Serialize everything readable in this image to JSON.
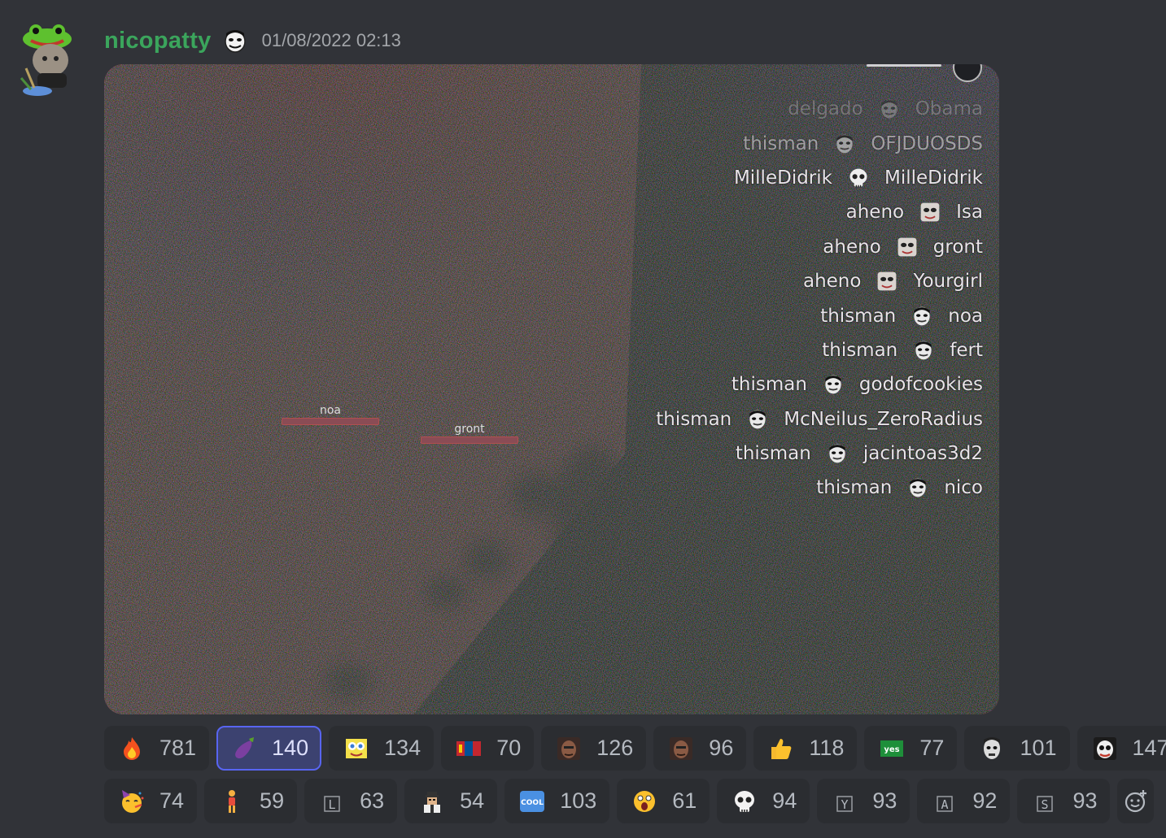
{
  "message": {
    "username": "nicopatty",
    "timestamp": "01/08/2022 02:13"
  },
  "colors": {
    "username": "#3ba55c",
    "background": "#313338",
    "reaction_bg": "#2b2d31",
    "reaction_selected_bg": "#3c4270",
    "reaction_selected_border": "#5865f2"
  },
  "embed": {
    "nametags": [
      {
        "label": "noa"
      },
      {
        "label": "gront"
      }
    ],
    "kill_feed": [
      {
        "killer": "delgado",
        "victim": "Obama"
      },
      {
        "killer": "thisman",
        "victim": "OFJDUOSDS"
      },
      {
        "killer": "MilleDidrik",
        "victim": "MilleDidrik",
        "icon": "skull-icon"
      },
      {
        "killer": "aheno",
        "victim": "Isa"
      },
      {
        "killer": "aheno",
        "victim": "gront"
      },
      {
        "killer": "aheno",
        "victim": "Yourgirl"
      },
      {
        "killer": "thisman",
        "victim": "noa"
      },
      {
        "killer": "thisman",
        "victim": "fert"
      },
      {
        "killer": "thisman",
        "victim": "godofcookies"
      },
      {
        "killer": "thisman",
        "victim": "McNeilus_ZeroRadius"
      },
      {
        "killer": "thisman",
        "victim": "jacintoas3d2"
      },
      {
        "killer": "thisman",
        "victim": "nico"
      }
    ]
  },
  "reactions": [
    [
      {
        "icon": "fire-icon",
        "count": "781"
      },
      {
        "icon": "eggplant-icon",
        "count": "140",
        "selected": true
      },
      {
        "icon": "spongebob-face-icon",
        "count": "134"
      },
      {
        "icon": "mongolia-flag-icon",
        "count": "70"
      },
      {
        "icon": "face-photo-icon",
        "count": "126"
      },
      {
        "icon": "face-photo-icon",
        "count": "96"
      },
      {
        "icon": "thumbs-up-icon",
        "count": "118"
      },
      {
        "icon": "yes-sticker-icon",
        "count": "77"
      },
      {
        "icon": "pale-face-icon",
        "count": "101"
      },
      {
        "icon": "scary-face-icon",
        "count": "147"
      }
    ],
    [
      {
        "icon": "party-face-icon",
        "count": "74"
      },
      {
        "icon": "standing-person-icon",
        "count": "59"
      },
      {
        "icon": "letter-L-icon",
        "count": "63",
        "letter": "L"
      },
      {
        "icon": "pixel-character-icon",
        "count": "54"
      },
      {
        "icon": "cool-button-icon",
        "count": "103",
        "text": "COOL"
      },
      {
        "icon": "shocked-face-icon",
        "count": "61"
      },
      {
        "icon": "skull-icon",
        "count": "94"
      },
      {
        "icon": "letter-Y-icon",
        "count": "93",
        "letter": "Y"
      },
      {
        "icon": "letter-A-icon",
        "count": "92",
        "letter": "A"
      },
      {
        "icon": "letter-S-icon",
        "count": "93",
        "letter": "S"
      }
    ]
  ]
}
